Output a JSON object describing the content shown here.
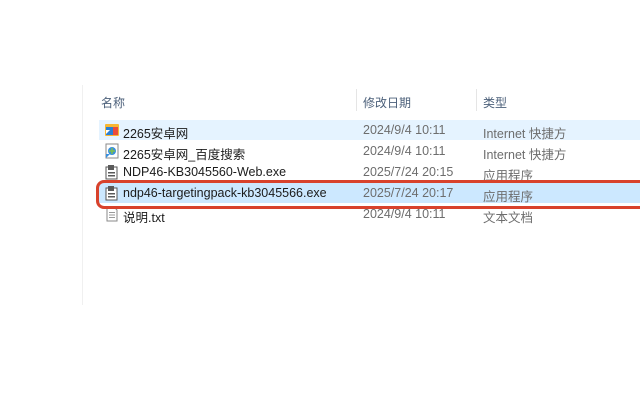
{
  "columns": {
    "name": "名称",
    "date_modified": "修改日期",
    "type": "类型"
  },
  "files": [
    {
      "name": "2265安卓网",
      "date": "2024/9/4 10:11",
      "type": "Internet 快捷方",
      "icon": "internet-shortcut-icon",
      "state": "hover"
    },
    {
      "name": "2265安卓网_百度搜索",
      "date": "2024/9/4 10:11",
      "type": "Internet 快捷方",
      "icon": "internet-shortcut-icon",
      "state": "normal"
    },
    {
      "name": "NDP46-KB3045560-Web.exe",
      "date": "2025/7/24 20:15",
      "type": "应用程序",
      "icon": "installer-exe-icon",
      "state": "normal"
    },
    {
      "name": "ndp46-targetingpack-kb3045566.exe",
      "date": "2025/7/24 20:17",
      "type": "应用程序",
      "icon": "installer-exe-icon",
      "state": "selected"
    },
    {
      "name": "说明.txt",
      "date": "2024/9/4 10:11",
      "type": "文本文档",
      "icon": "text-file-icon",
      "state": "normal"
    }
  ],
  "colors": {
    "hover_bg": "#e5f3ff",
    "selected_bg": "#cce8ff",
    "highlight_border": "#d8422c",
    "header_text": "#4c607a"
  }
}
